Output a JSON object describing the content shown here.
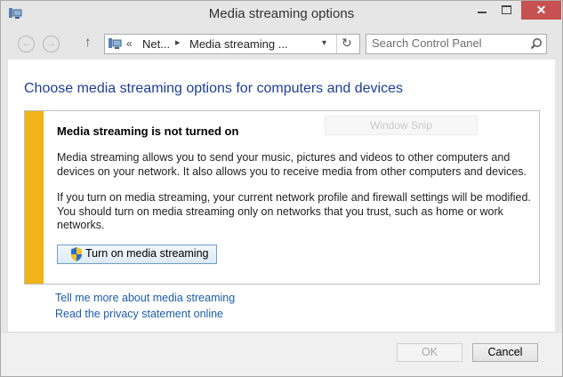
{
  "window": {
    "title": "Media streaming options"
  },
  "titlebar": {
    "close_glyph": "✕"
  },
  "nav": {
    "back_glyph": "←",
    "forward_glyph": "→",
    "up_glyph": "↑",
    "chevrons": "«",
    "crumb_separator": "▸",
    "breadcrumbs": [
      "Net...",
      "Media streaming ..."
    ],
    "dropdown_glyph": "▾",
    "refresh_glyph": "↻",
    "search_placeholder": "Search Control Panel"
  },
  "content": {
    "heading": "Choose media streaming options for computers and devices",
    "notice": {
      "title": "Media streaming is not turned on",
      "paragraph1": "Media streaming allows you to send your music, pictures and videos to other computers and devices on your network.  It also allows you to receive media from other computers and devices.",
      "paragraph2": "If you turn on media streaming, your current network profile and firewall settings will be modified. You should turn on media streaming only on networks that you trust, such as home or work networks.",
      "button_label": "Turn on media streaming",
      "accent_color": "#f0b418"
    },
    "overlay_text": "Window Snip",
    "links": [
      "Tell me more about media streaming",
      "Read the privacy statement online"
    ]
  },
  "footer": {
    "ok_label": "OK",
    "cancel_label": "Cancel"
  },
  "colors": {
    "heading": "#1e3e96",
    "link": "#1c5dad",
    "close_button": "#c75050"
  },
  "icons": [
    "network-media-icon",
    "minimize-icon",
    "maximize-icon",
    "close-icon",
    "back-arrow-icon",
    "forward-arrow-icon",
    "up-arrow-icon",
    "refresh-icon",
    "search-icon",
    "uac-shield-icon"
  ]
}
